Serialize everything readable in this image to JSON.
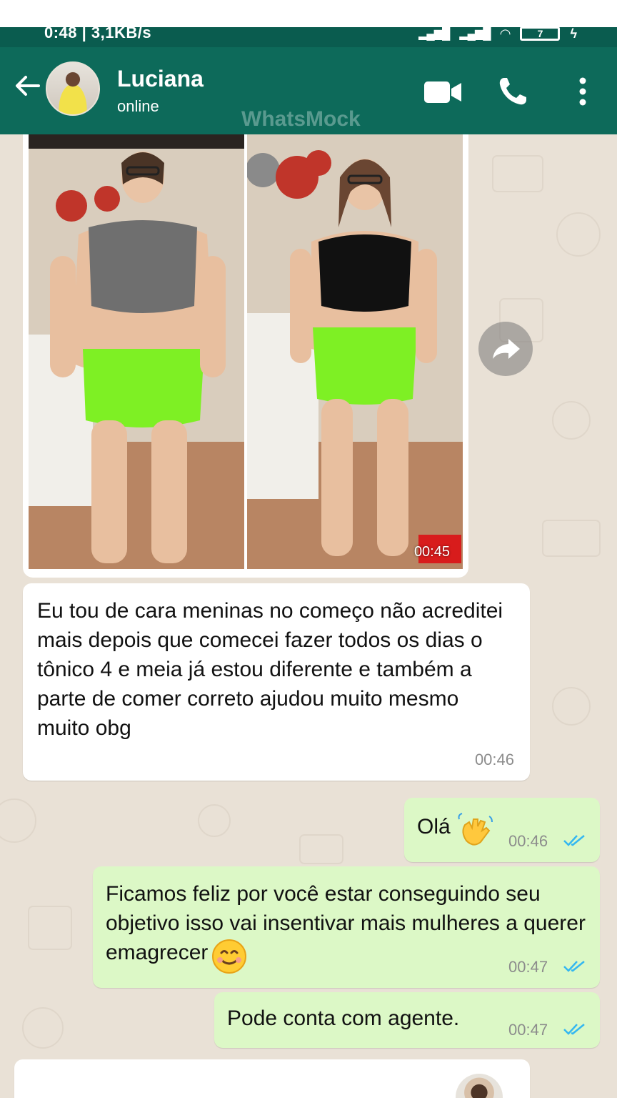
{
  "status_bar": {
    "left": "0:48 | 3,1KB/s",
    "battery": "7"
  },
  "header": {
    "contact_name": "Luciana",
    "contact_status": "online",
    "watermark": "WhatsMock",
    "icons": [
      "back-arrow-icon",
      "avatar",
      "video-call-icon",
      "phone-icon",
      "more-vert-icon"
    ]
  },
  "messages": [
    {
      "direction": "incoming",
      "type": "image",
      "time": "00:45"
    },
    {
      "direction": "incoming",
      "type": "text",
      "text": "Eu tou de cara meninas no começo não acreditei mais depois que comecei fazer todos os dias o tônico 4 e meia já estou diferente e também a parte de comer correto ajudou muito mesmo muito obg",
      "time": "00:46"
    },
    {
      "direction": "outgoing",
      "type": "text",
      "text": "Olá",
      "emoji": "waving-hand-icon",
      "time": "00:46",
      "read": true
    },
    {
      "direction": "outgoing",
      "type": "text",
      "text": "Ficamos feliz por você estar conseguindo seu objetivo isso vai insentivar mais mulheres a querer emagrecer",
      "emoji": "smiling-face-icon",
      "time": "00:47",
      "read": true
    },
    {
      "direction": "outgoing",
      "type": "text",
      "text": "Pode conta com agente.",
      "time": "00:47",
      "read": true
    }
  ],
  "colors": {
    "header": "#0d6a5a",
    "status_bar": "#0a5c4f",
    "chat_background": "#e9e1d6",
    "incoming_bubble": "#ffffff",
    "outgoing_bubble": "#dcf8c6",
    "read_ticks": "#34b7f1"
  }
}
